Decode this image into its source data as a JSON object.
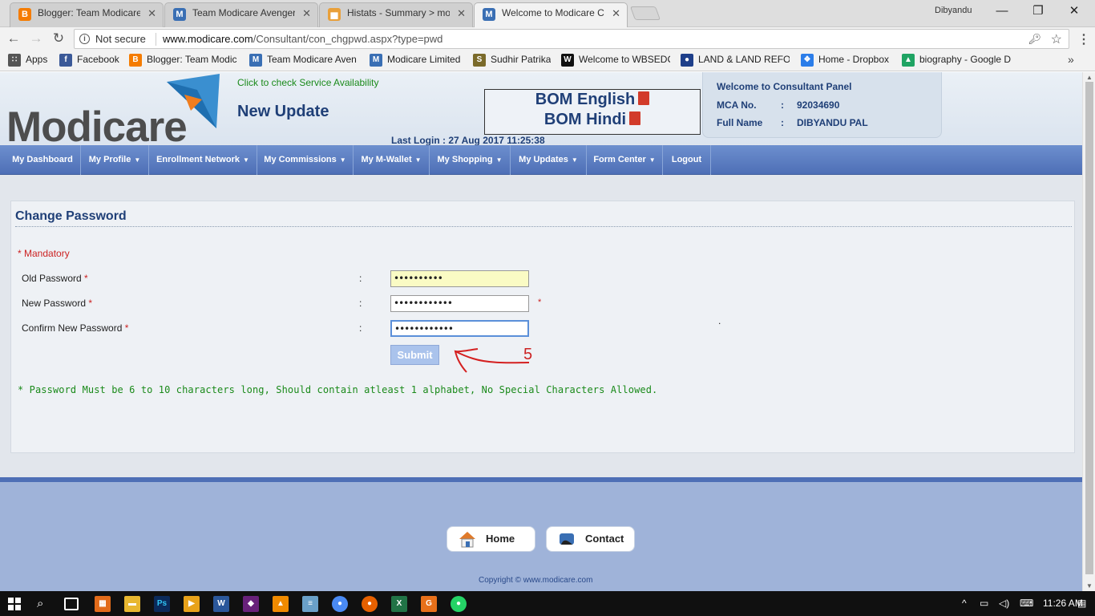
{
  "browser": {
    "tabs": [
      {
        "title": "Blogger: Team Modicare",
        "favicon": "blogger-icon",
        "color": "#f57c00",
        "glyph": "B"
      },
      {
        "title": "Team Modicare Avengers",
        "favicon": "modicare-icon",
        "color": "#3a6fb4",
        "glyph": "M"
      },
      {
        "title": "Histats - Summary > mo",
        "favicon": "histats-icon",
        "color": "#e9a03a",
        "glyph": "▅"
      },
      {
        "title": "Welcome to Modicare Co",
        "favicon": "modicare-icon",
        "color": "#3a6fb4",
        "glyph": "M"
      }
    ],
    "user": "Dibyandu",
    "window_controls": {
      "minimize": "—",
      "restore": "❐",
      "close": "✕"
    },
    "nav": {
      "back": "←",
      "forward": "→",
      "reload": "↻"
    },
    "address": {
      "security": "Not secure",
      "host": "www.modicare.com",
      "path": "/Consultant/con_chgpwd.aspx?type=pwd"
    },
    "bookmarks": [
      {
        "label": "Apps",
        "icon": "apps-icon",
        "color": "#555",
        "glyph": "∷"
      },
      {
        "label": "Facebook",
        "icon": "facebook-icon",
        "color": "#3b5998",
        "glyph": "f"
      },
      {
        "label": "Blogger: Team Modic",
        "icon": "blogger-icon",
        "color": "#f57c00",
        "glyph": "B"
      },
      {
        "label": "Team Modicare Aven",
        "icon": "modicare-icon",
        "color": "#3a6fb4",
        "glyph": "M"
      },
      {
        "label": "Modicare Limited",
        "icon": "modicare-icon",
        "color": "#3a6fb4",
        "glyph": "M"
      },
      {
        "label": "Sudhir Patrika",
        "icon": "sudhir-icon",
        "color": "#7a6a2a",
        "glyph": "S"
      },
      {
        "label": "Welcome to WBSEDC",
        "icon": "wbsedc-icon",
        "color": "#111",
        "glyph": "W"
      },
      {
        "label": "LAND & LAND REFO",
        "icon": "land-icon",
        "color": "#1e3f8a",
        "glyph": "●"
      },
      {
        "label": "Home - Dropbox",
        "icon": "dropbox-icon",
        "color": "#2b7de9",
        "glyph": "❖"
      },
      {
        "label": "biography - Google D",
        "icon": "google-drive-icon",
        "color": "#1fa463",
        "glyph": "▲"
      }
    ],
    "more": "»"
  },
  "header": {
    "logo": "Modicare",
    "service_link": "Click to check Service Availability",
    "new_update": "New Update",
    "bom_english": "BOM English",
    "bom_hindi": "BOM Hindi",
    "last_login": "Last Login : 27 Aug 2017 11:25:38",
    "panel": {
      "title": "Welcome to Consultant Panel",
      "mca_label": "MCA No.",
      "mca_value": "92034690",
      "name_label": "Full Name",
      "name_value": "DIBYANDU PAL",
      "colon": ":"
    }
  },
  "nav": [
    {
      "label": "My Dashboard",
      "caret": false
    },
    {
      "label": "My Profile",
      "caret": true
    },
    {
      "label": "Enrollment Network",
      "caret": true
    },
    {
      "label": "My Commissions",
      "caret": true
    },
    {
      "label": "My M-Wallet",
      "caret": true
    },
    {
      "label": "My Shopping",
      "caret": true
    },
    {
      "label": "My Updates",
      "caret": true
    },
    {
      "label": "Form Center",
      "caret": true
    },
    {
      "label": "Logout",
      "caret": false
    }
  ],
  "form": {
    "title": "Change Password",
    "mandatory": "* Mandatory",
    "colon": ":",
    "fields": [
      {
        "label": "Old Password",
        "value": "••••••••••"
      },
      {
        "label": "New Password",
        "value": "••••••••••••"
      },
      {
        "label": "Confirm New Password",
        "value": "••••••••••••"
      }
    ],
    "required_mark": "*",
    "submit": "Submit",
    "annotation_number": "5",
    "note": "* Password Must be 6 to 10 characters long, Should contain atleast 1 alphabet, No Special Characters Allowed."
  },
  "footer": {
    "home": "Home",
    "contact": "Contact",
    "copyright": "Copyright © www.modicare.com"
  },
  "taskbar": {
    "time": "11:26 AM",
    "apps": [
      {
        "icon": "app-icon-1",
        "color": "#e26b1a",
        "glyph": "▦"
      },
      {
        "icon": "file-explorer-icon",
        "color": "#e8b730",
        "glyph": "▬"
      },
      {
        "icon": "photoshop-icon",
        "color": "#0b2a5a",
        "glyph": "Ps"
      },
      {
        "icon": "media-player-icon",
        "color": "#e8a21a",
        "glyph": "▶"
      },
      {
        "icon": "word-icon",
        "color": "#2b579a",
        "glyph": "W"
      },
      {
        "icon": "visual-studio-icon",
        "color": "#68217a",
        "glyph": "◆"
      },
      {
        "icon": "vlc-icon",
        "color": "#f08a00",
        "glyph": "▲"
      },
      {
        "icon": "notepad-icon",
        "color": "#6aa0c8",
        "glyph": "≡"
      },
      {
        "icon": "chrome-icon",
        "color": "#4a8af4",
        "glyph": "●"
      },
      {
        "icon": "firefox-icon",
        "color": "#e66000",
        "glyph": "●"
      },
      {
        "icon": "excel-icon",
        "color": "#217346",
        "glyph": "X"
      },
      {
        "icon": "app-icon-g",
        "color": "#e8701a",
        "glyph": "G"
      },
      {
        "icon": "whatsapp-icon",
        "color": "#25d366",
        "glyph": "●"
      }
    ]
  }
}
